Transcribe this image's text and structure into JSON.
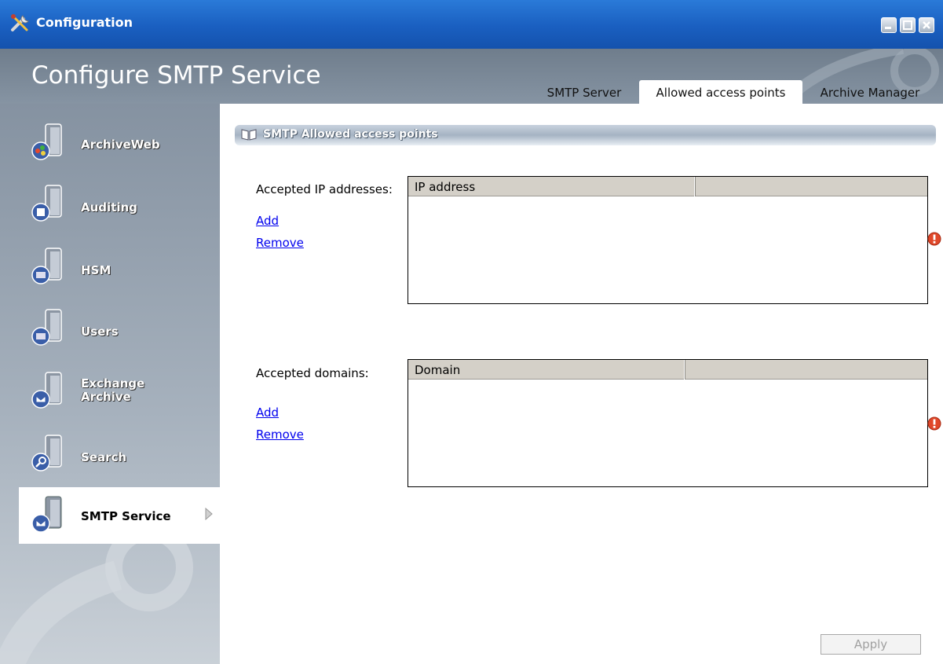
{
  "window": {
    "title": "Configuration"
  },
  "header": {
    "page_title": "Configure SMTP Service"
  },
  "tabs": [
    {
      "label": "SMTP Server"
    },
    {
      "label": "Allowed access points",
      "active": true
    },
    {
      "label": "Archive Manager"
    }
  ],
  "sidebar": {
    "items": [
      {
        "label": "ArchiveWeb",
        "icon": "archiveweb-icon"
      },
      {
        "label": "Auditing",
        "icon": "auditing-icon"
      },
      {
        "label": "HSM",
        "icon": "hsm-icon"
      },
      {
        "label": "Users",
        "icon": "users-icon"
      },
      {
        "label_line1": "Exchange",
        "label_line2": "Archive",
        "icon": "exchange-archive-icon"
      },
      {
        "label": "Search",
        "icon": "search-icon"
      },
      {
        "label": "SMTP Service",
        "icon": "smtp-service-icon",
        "active": true
      }
    ]
  },
  "section": {
    "title": "SMTP Allowed access points"
  },
  "ip_group": {
    "label": "Accepted IP addresses:",
    "add": "Add",
    "remove": "Remove",
    "columns": [
      "IP address",
      ""
    ]
  },
  "domain_group": {
    "label": "Accepted domains:",
    "add": "Add",
    "remove": "Remove",
    "columns": [
      "Domain",
      ""
    ]
  },
  "apply_label": "Apply",
  "colors": {
    "titlebar": "#1a5fc0",
    "link": "#0000ee",
    "warning": "#e0482a"
  }
}
